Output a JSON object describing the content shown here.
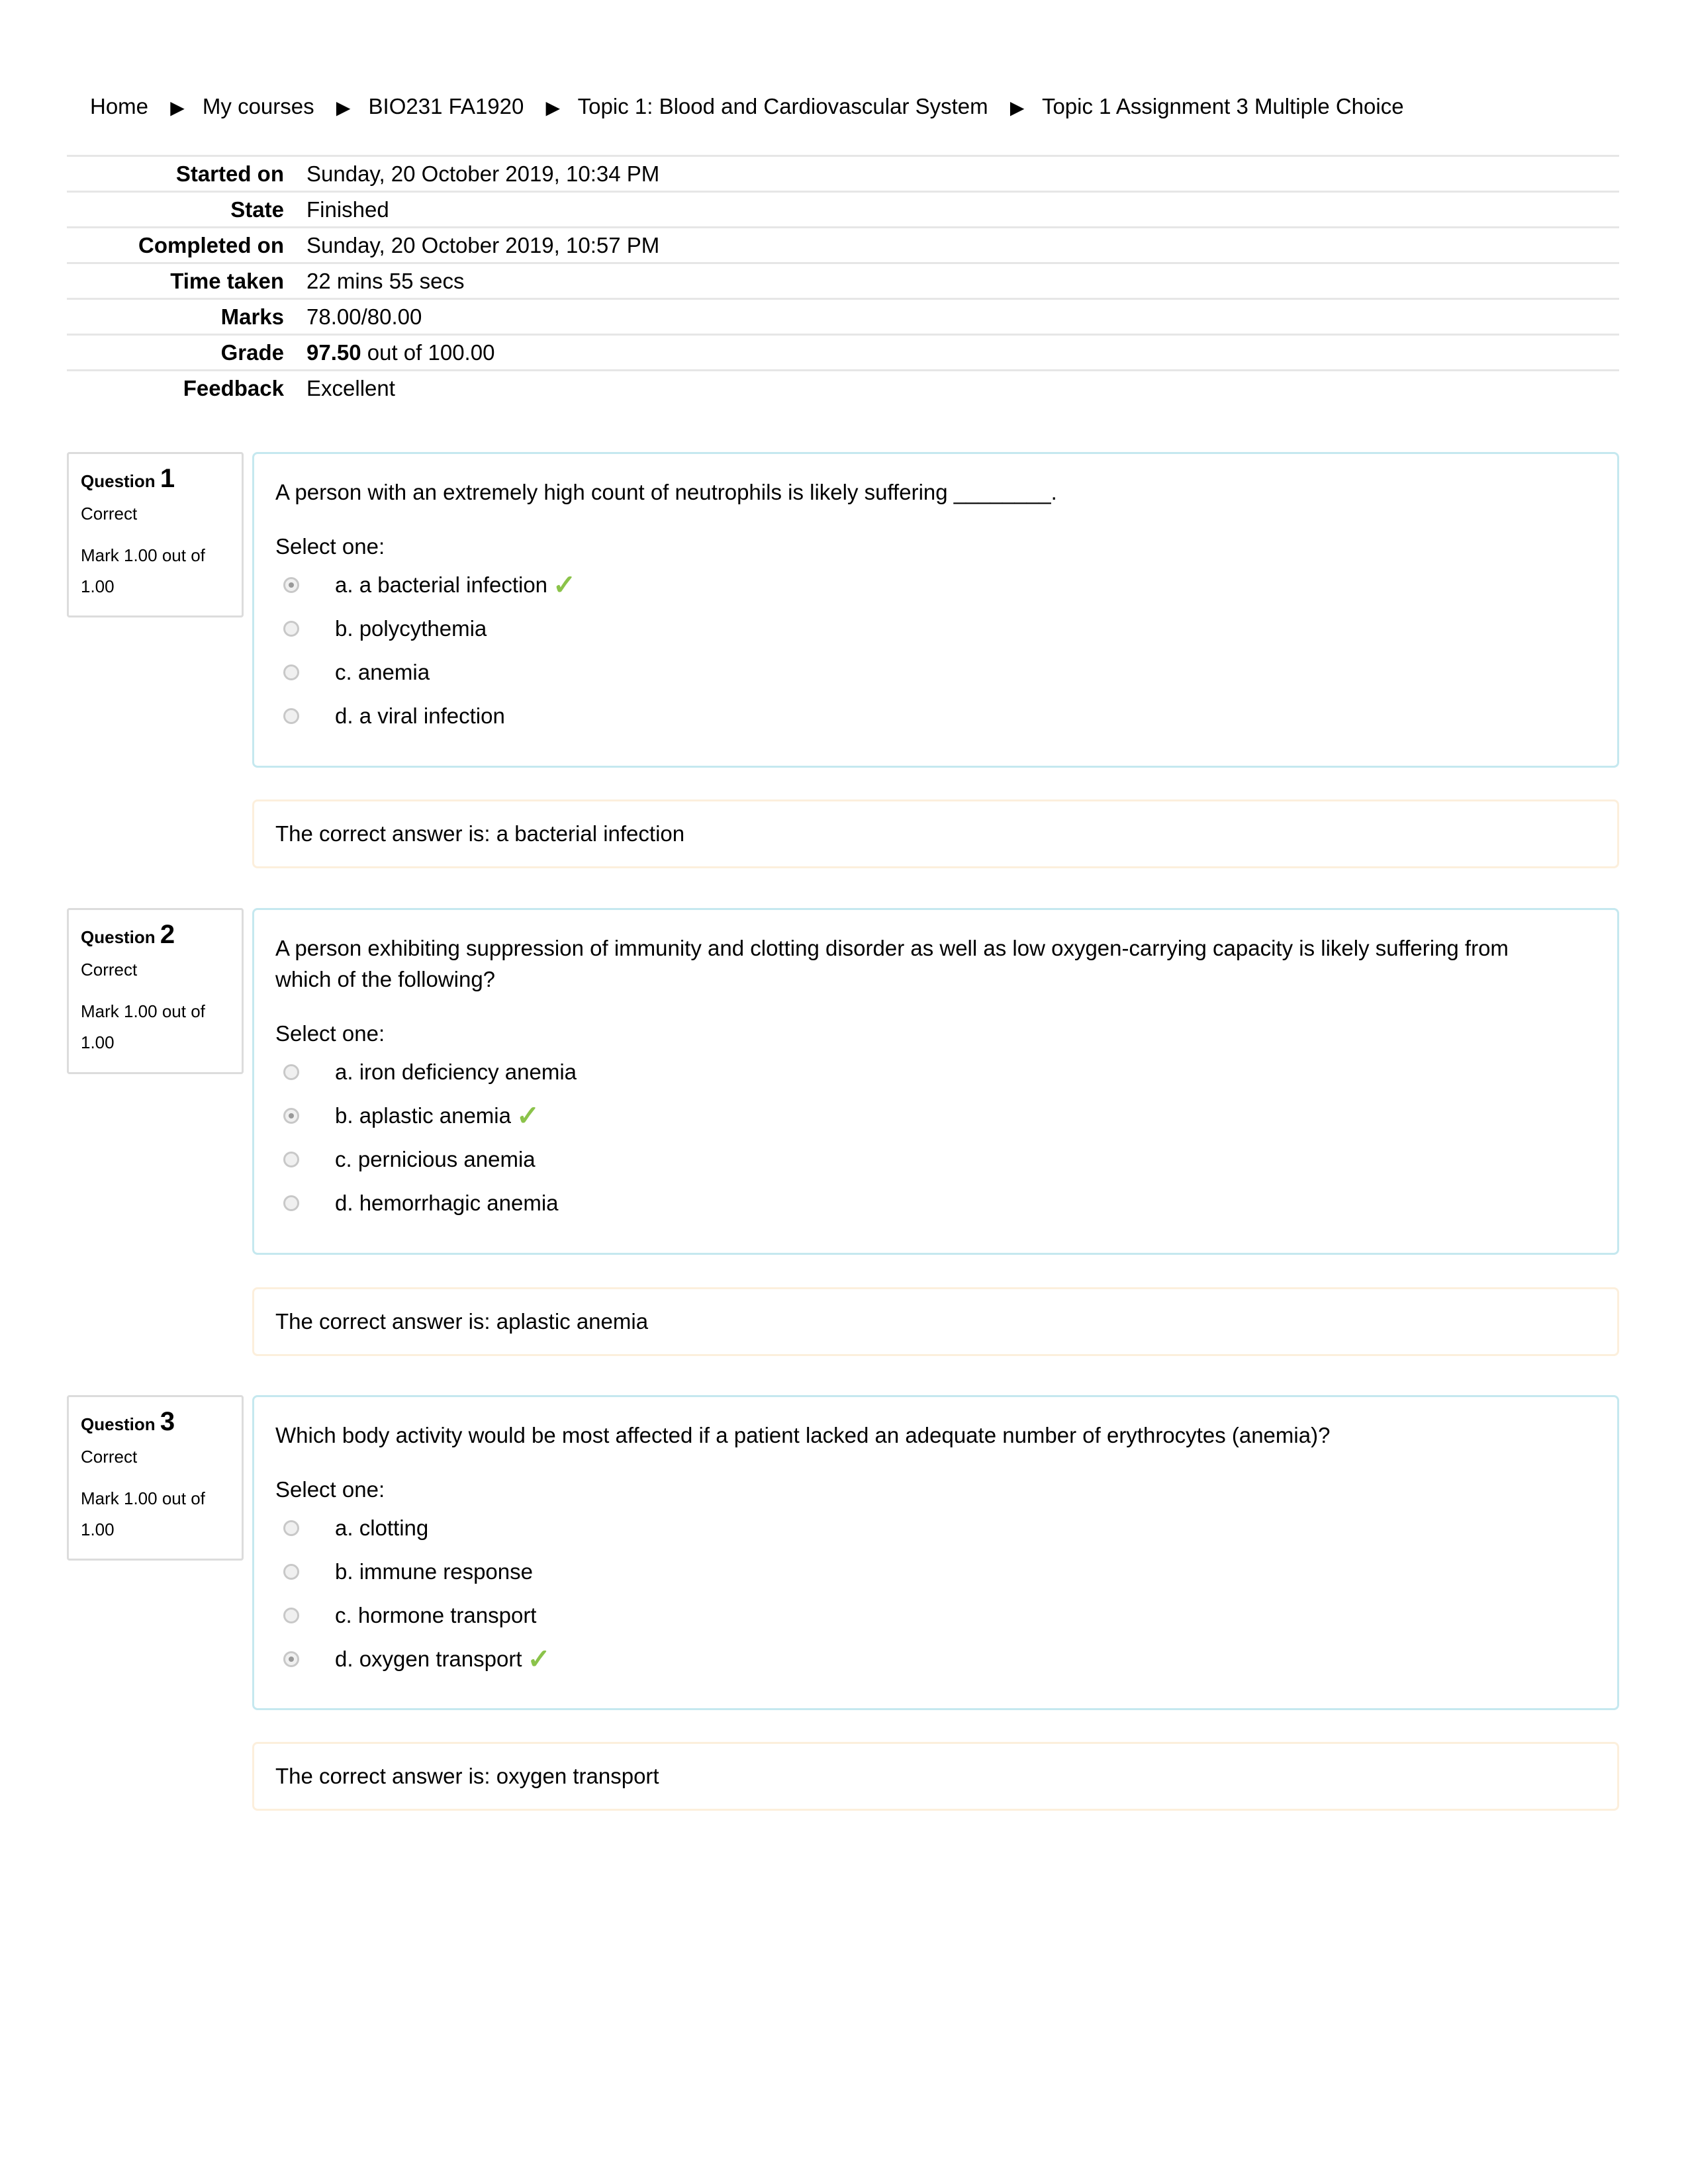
{
  "breadcrumb": [
    {
      "label": "Home"
    },
    {
      "label": "My courses"
    },
    {
      "label": "BIO231 FA1920"
    },
    {
      "label": "Topic 1: Blood and Cardiovascular System"
    },
    {
      "label": "Topic 1 Assignment 3 Multiple Choice"
    }
  ],
  "breadcrumb_separator": "▶",
  "summary": {
    "started_on": {
      "label": "Started on",
      "value": "Sunday, 20 October 2019, 10:34 PM"
    },
    "state": {
      "label": "State",
      "value": "Finished"
    },
    "completed_on": {
      "label": "Completed on",
      "value": "Sunday, 20 October 2019, 10:57 PM"
    },
    "time_taken": {
      "label": "Time taken",
      "value": "22 mins 55 secs"
    },
    "marks": {
      "label": "Marks",
      "value": "78.00/80.00"
    },
    "grade": {
      "label": "Grade",
      "value_bold": "97.50",
      "value_rest": " out of 100.00"
    },
    "feedback": {
      "label": "Feedback",
      "value": "Excellent"
    }
  },
  "questions": [
    {
      "title": "Question",
      "number": "1",
      "state": "Correct",
      "grade": "Mark 1.00 out of 1.00",
      "text": "A person with an extremely high count of neutrophils is likely suffering ________.",
      "prompt": "Select one:",
      "options": [
        {
          "label": "a. a bacterial infection",
          "selected": true,
          "correct": true
        },
        {
          "label": "b. polycythemia",
          "selected": false,
          "correct": false
        },
        {
          "label": "c. anemia",
          "selected": false,
          "correct": false
        },
        {
          "label": "d. a viral infection",
          "selected": false,
          "correct": false
        }
      ],
      "feedback": "The correct answer is: a bacterial infection"
    },
    {
      "title": "Question",
      "number": "2",
      "state": "Correct",
      "grade": "Mark 1.00 out of 1.00",
      "text": "A person exhibiting suppression of immunity and clotting disorder as well as low oxygen-carrying capacity is likely suffering from which of the following?",
      "prompt": "Select one:",
      "options": [
        {
          "label": "a. iron deficiency anemia",
          "selected": false,
          "correct": false
        },
        {
          "label": "b. aplastic anemia",
          "selected": true,
          "correct": true
        },
        {
          "label": "c. pernicious anemia",
          "selected": false,
          "correct": false
        },
        {
          "label": "d. hemorrhagic anemia",
          "selected": false,
          "correct": false
        }
      ],
      "feedback": "The correct answer is: aplastic anemia"
    },
    {
      "title": "Question",
      "number": "3",
      "state": "Correct",
      "grade": "Mark 1.00 out of 1.00",
      "text": "Which body activity would be most affected if a patient lacked an adequate number of erythrocytes (anemia)?",
      "prompt": "Select one:",
      "options": [
        {
          "label": "a. clotting",
          "selected": false,
          "correct": false
        },
        {
          "label": "b. immune response",
          "selected": false,
          "correct": false
        },
        {
          "label": "c. hormone transport",
          "selected": false,
          "correct": false
        },
        {
          "label": "d. oxygen transport",
          "selected": true,
          "correct": true
        }
      ],
      "feedback": "The correct answer is: oxygen transport"
    }
  ],
  "icons": {
    "check": "✓",
    "correct_icon_color": "#8bc34a"
  }
}
